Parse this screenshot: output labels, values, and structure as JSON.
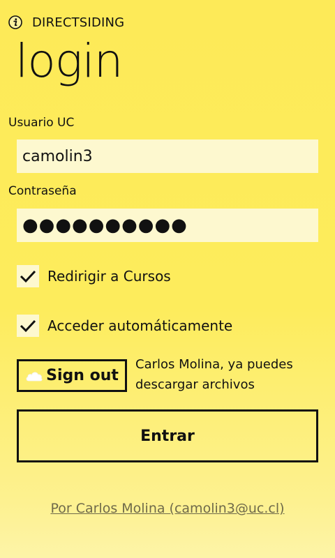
{
  "header": {
    "app_title": "DIRECTSIDING",
    "icon": "info-icon"
  },
  "page": {
    "title": "login"
  },
  "form": {
    "username_label": "Usuario UC",
    "username_value": "camolin3",
    "password_label": "Contraseña",
    "password_value": "●●●●●●●●●●",
    "redirect_checkbox": {
      "label": "Redirigir a Cursos",
      "checked": true
    },
    "autologin_checkbox": {
      "label": "Acceder automáticamente",
      "checked": true
    }
  },
  "signout": {
    "label": "Sign out",
    "icon": "skydrive-cloud-icon",
    "status_message": "Carlos Molina, ya puedes descargar archivos"
  },
  "actions": {
    "enter_label": "Entrar"
  },
  "footer": {
    "credits": "Por Carlos Molina (camolin3@uc.cl)"
  },
  "colors": {
    "background": "#fdea58",
    "input_background": "#fdf8cf",
    "text": "#111111",
    "link": "#6f6a4a"
  }
}
